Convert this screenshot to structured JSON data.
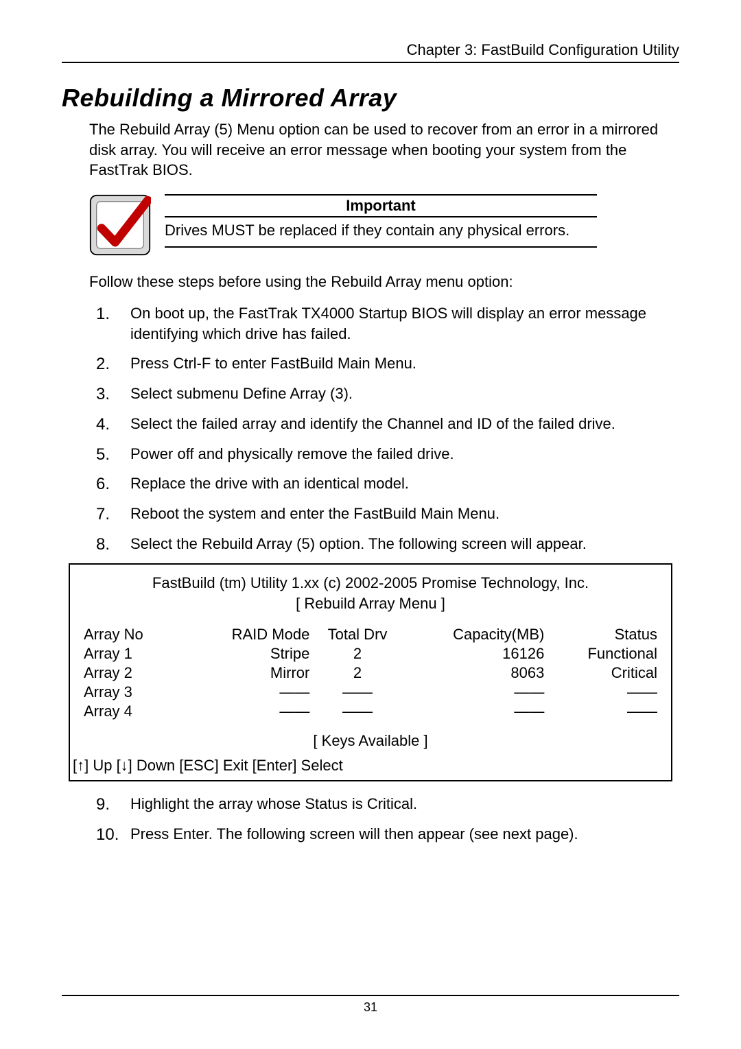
{
  "chapter": "Chapter 3: FastBuild Configuration Utility",
  "title": "Rebuilding a Mirrored Array",
  "intro": "The Rebuild Array (5) Menu option can be used to recover from an error in a mirrored disk array. You will receive an error message when booting your system from the FastTrak BIOS.",
  "callout": {
    "title": "Important",
    "text": "Drives MUST be replaced if they contain any physical errors."
  },
  "follow": "Follow these steps before using the Rebuild Array menu option:",
  "steps": [
    "On boot up, the FastTrak TX4000 Startup BIOS will display an error message identifying which drive has failed.",
    "Press Ctrl-F to enter FastBuild Main Menu.",
    "Select submenu Define Array (3).",
    "Select the failed array and identify the Channel and ID of the failed drive.",
    "Power off and physically remove the failed drive.",
    "Replace the drive with an identical model.",
    "Reboot the system and enter the FastBuild Main Menu.",
    "Select the Rebuild Array (5) option. The following screen will appear."
  ],
  "screen": {
    "head": "FastBuild (tm) Utility 1.xx (c) 2002-2005 Promise Technology, Inc.",
    "sub": "[ Rebuild Array Menu ]",
    "headers": {
      "c1": "Array No",
      "c2": "RAID Mode",
      "c3": "Total Drv",
      "c4": "Capacity(MB)",
      "c5": "Status"
    },
    "rows": [
      {
        "c1": "Array 1",
        "c2": "Stripe",
        "c3": "2",
        "c4": "16126",
        "c5": "Functional"
      },
      {
        "c1": "Array 2",
        "c2": "Mirror",
        "c3": "2",
        "c4": "8063",
        "c5": "Critical"
      },
      {
        "c1": "Array 3",
        "c2": "——",
        "c3": "——",
        "c4": "——",
        "c5": "——"
      },
      {
        "c1": "Array 4",
        "c2": "——",
        "c3": "——",
        "c4": "——",
        "c5": "——"
      }
    ],
    "keys_avail": "[ Keys Available ]",
    "keys_line": "[↑] Up [↓] Down    [ESC] Exit    [Enter] Select"
  },
  "steps_after": [
    "Highlight the array whose Status is Critical.",
    "Press Enter. The following screen will then appear (see next page)."
  ],
  "page_number": "31"
}
